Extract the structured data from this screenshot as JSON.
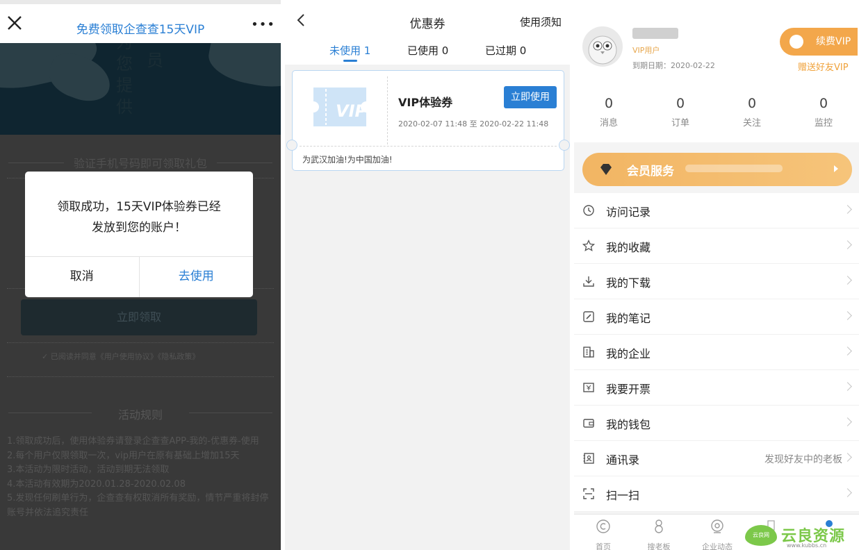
{
  "panel1": {
    "title": "免费领取企查查15天VIP",
    "more": "•••",
    "banner_text": [
      "为",
      "您",
      "提",
      "供"
    ],
    "banner_text2": "员",
    "verify_text": "验证手机号码即可领取礼包",
    "claim_button": "立即领取",
    "agreement": "✓ 已阅读并同意《用户使用协议》《隐私政策》",
    "rules_title": "活动规则",
    "rules": [
      "1.领取成功后，使用体验券请登录企查查APP-我的-优惠券-使用",
      "2.每个用户仅限领取一次，vip用户在原有基础上增加15天",
      "3.本活动为限时活动，活动到期无法领取",
      "4.本活动有效期为2020.01.28-2020.02.08",
      "5.发现任何刷单行为，企查查有权取消所有奖励，情节严重将封停账号并依法追究责任"
    ],
    "dialog": {
      "message_line1": "领取成功，15天VIP体验券已经",
      "message_line2": "发放到您的账户！",
      "cancel": "取消",
      "use": "去使用"
    }
  },
  "panel2": {
    "title": "优惠券",
    "notice": "使用须知",
    "tabs": [
      "未使用 1",
      "已使用 0",
      "已过期 0"
    ],
    "coupon": {
      "name": "VIP体验券",
      "use_button": "立即使用",
      "validity": "2020-02-07 11:48 至 2020-02-22 11:48",
      "slogan": "为武汉加油!为中国加油!",
      "ticket_label": "VIP"
    }
  },
  "panel3": {
    "vip_user": "VIP用户",
    "expire": "到期日期：2020-02-22",
    "renew": "续费VIP",
    "gift": "赠送好友VIP",
    "stats": [
      {
        "num": "0",
        "label": "消息"
      },
      {
        "num": "0",
        "label": "订单"
      },
      {
        "num": "0",
        "label": "关注"
      },
      {
        "num": "0",
        "label": "监控"
      }
    ],
    "member_service": "会员服务",
    "menu": [
      {
        "label": "访问记录",
        "icon": "clock-icon",
        "hint": ""
      },
      {
        "label": "我的收藏",
        "icon": "star-icon",
        "hint": ""
      },
      {
        "label": "我的下载",
        "icon": "download-icon",
        "hint": ""
      },
      {
        "label": "我的笔记",
        "icon": "note-icon",
        "hint": ""
      },
      {
        "label": "我的企业",
        "icon": "building-icon",
        "hint": ""
      },
      {
        "label": "我要开票",
        "icon": "invoice-icon",
        "hint": ""
      },
      {
        "label": "我的钱包",
        "icon": "wallet-icon",
        "hint": ""
      },
      {
        "label": "通讯录",
        "icon": "contacts-icon",
        "hint": "发现好友中的老板"
      },
      {
        "label": "扫一扫",
        "icon": "scan-icon",
        "hint": ""
      }
    ],
    "tabbar": [
      "首页",
      "搜老板",
      "企业动态"
    ],
    "watermark": {
      "small": "云良网",
      "big": "云良资源网",
      "url": "www.kubbs.cn"
    }
  }
}
